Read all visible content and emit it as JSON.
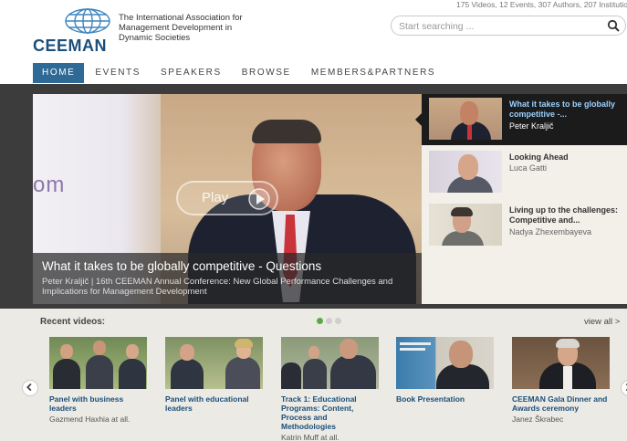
{
  "header": {
    "logo_text": "CEEMAN",
    "tagline": "The International Association for Management Development in Dynamic Societies",
    "stats": "175 Videos, 12 Events, 307 Authors, 207 Institutions",
    "search_placeholder": "Start searching ..."
  },
  "nav": {
    "items": [
      {
        "label": "HOME"
      },
      {
        "label": "EVENTS"
      },
      {
        "label": "SPEAKERS"
      },
      {
        "label": "BROWSE"
      },
      {
        "label": "MEMBERS&PARTNERS"
      }
    ]
  },
  "hero": {
    "play_label": "Play",
    "overlay_text": "om",
    "caption_title": "What it takes to be globally competitive - Questions",
    "caption_sub": "Peter Kraljič | 16th CEEMAN Annual Conference: New Global Performance Challenges and Implications for Management Development",
    "playlist": [
      {
        "title": "What it takes to be globally competitive -...",
        "author": "Peter Kraljič"
      },
      {
        "title": "Looking Ahead",
        "author": "Luca Gatti"
      },
      {
        "title": "Living up to the challenges: Competitive and...",
        "author": "Nadya Zhexembayeva"
      }
    ]
  },
  "recent": {
    "title": "Recent videos:",
    "view_all": "view all >",
    "videos": [
      {
        "title": "Panel with business leaders",
        "author": "Gazmend Haxhia at all."
      },
      {
        "title": "Panel with educational leaders",
        "author": ""
      },
      {
        "title": "Track 1: Educational Programs: Content, Process and Methodologies",
        "author": "Katrin Muff at all."
      },
      {
        "title": "Book Presentation",
        "author": ""
      },
      {
        "title": "CEEMAN Gala Dinner and Awards ceremony",
        "author": "Janez Škrabec"
      }
    ]
  },
  "colors": {
    "brand_blue": "#2f6a97",
    "title_blue": "#1b4f7a",
    "active_link": "#9ad1ff",
    "dot_active": "#59a948"
  }
}
